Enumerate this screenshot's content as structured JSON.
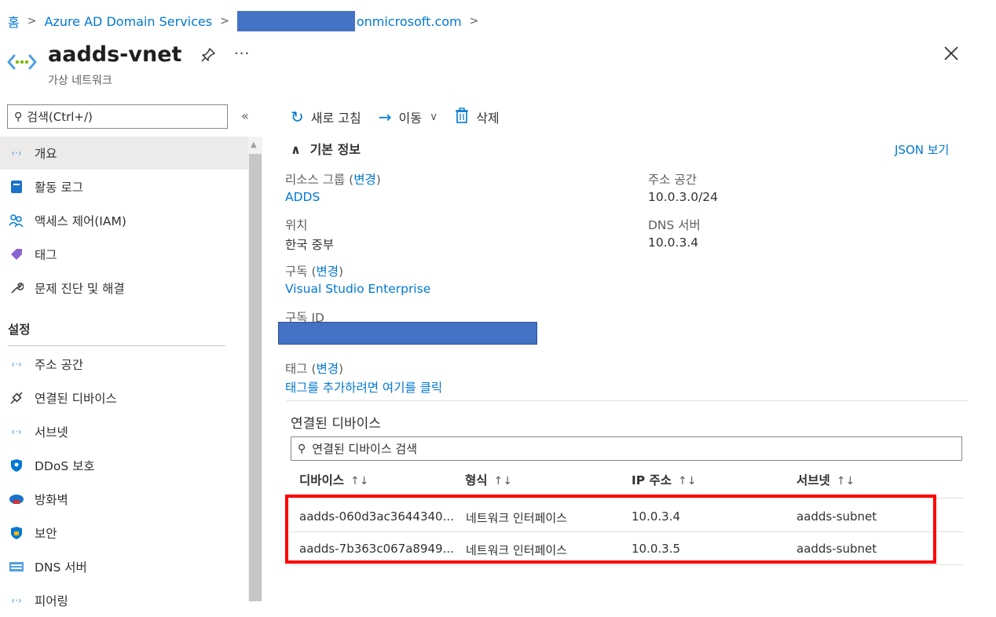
{
  "breadcrumb": {
    "home": "홈",
    "service": "Azure AD Domain Services",
    "tenant_suffix": "onmicrosoft.com"
  },
  "header": {
    "title": "aadds-vnet",
    "subtitle": "가상 네트워크",
    "more": "···",
    "icon": "vnet-icon"
  },
  "sidebar": {
    "search_placeholder": "검색(Ctrl+/)",
    "collapse": "«",
    "items": [
      {
        "label": "개요",
        "icon": "vnet-icon",
        "active": true
      },
      {
        "label": "활동 로그",
        "icon": "activity-log-icon"
      },
      {
        "label": "액세스 제어(IAM)",
        "icon": "iam-icon"
      },
      {
        "label": "태그",
        "icon": "tag-icon"
      },
      {
        "label": "문제 진단 및 해결",
        "icon": "wrench-icon"
      }
    ],
    "section_settings": "설정",
    "settings_items": [
      {
        "label": "주소 공간",
        "icon": "vnet-icon"
      },
      {
        "label": "연결된 디바이스",
        "icon": "plug-icon"
      },
      {
        "label": "서브넷",
        "icon": "subnet-icon"
      },
      {
        "label": "DDoS 보호",
        "icon": "shield-icon"
      },
      {
        "label": "방화벽",
        "icon": "firewall-icon"
      },
      {
        "label": "보안",
        "icon": "security-icon"
      },
      {
        "label": "DNS 서버",
        "icon": "dns-icon"
      },
      {
        "label": "피어링",
        "icon": "peering-icon"
      }
    ]
  },
  "toolbar": {
    "refresh": "새로 고침",
    "move": "이동",
    "delete": "삭제"
  },
  "essentials": {
    "heading": "기본 정보",
    "json_view": "JSON 보기",
    "resource_group_label": "리소스 그룹",
    "change": "변경",
    "resource_group_value": "ADDS",
    "location_label": "위치",
    "location_value": "한국 중부",
    "subscription_label": "구독",
    "subscription_value": "Visual Studio Enterprise",
    "subscription_id_label": "구독 ID",
    "tags_label": "태그",
    "tags_value": "태그를 추가하려면 여기를 클릭",
    "address_space_label": "주소 공간",
    "address_space_value": "10.0.3.0/24",
    "dns_label": "DNS 서버",
    "dns_value": "10.0.3.4"
  },
  "devices": {
    "title": "연결된 디바이스",
    "search_placeholder": "연결된 디바이스 검색",
    "columns": [
      "디바이스",
      "형식",
      "IP 주소",
      "서브넷"
    ],
    "sort_glyph": "↑↓",
    "rows": [
      {
        "device": "aadds-060d3ac3644340...",
        "type": "네트워크 인터페이스",
        "ip": "10.0.3.4",
        "subnet": "aadds-subnet"
      },
      {
        "device": "aadds-7b363c067a8949...",
        "type": "네트워크 인터페이스",
        "ip": "10.0.3.5",
        "subnet": "aadds-subnet"
      }
    ]
  },
  "colors": {
    "accent": "#0078d4",
    "highlight": "#ff0000",
    "redaction": "#4472c4"
  }
}
